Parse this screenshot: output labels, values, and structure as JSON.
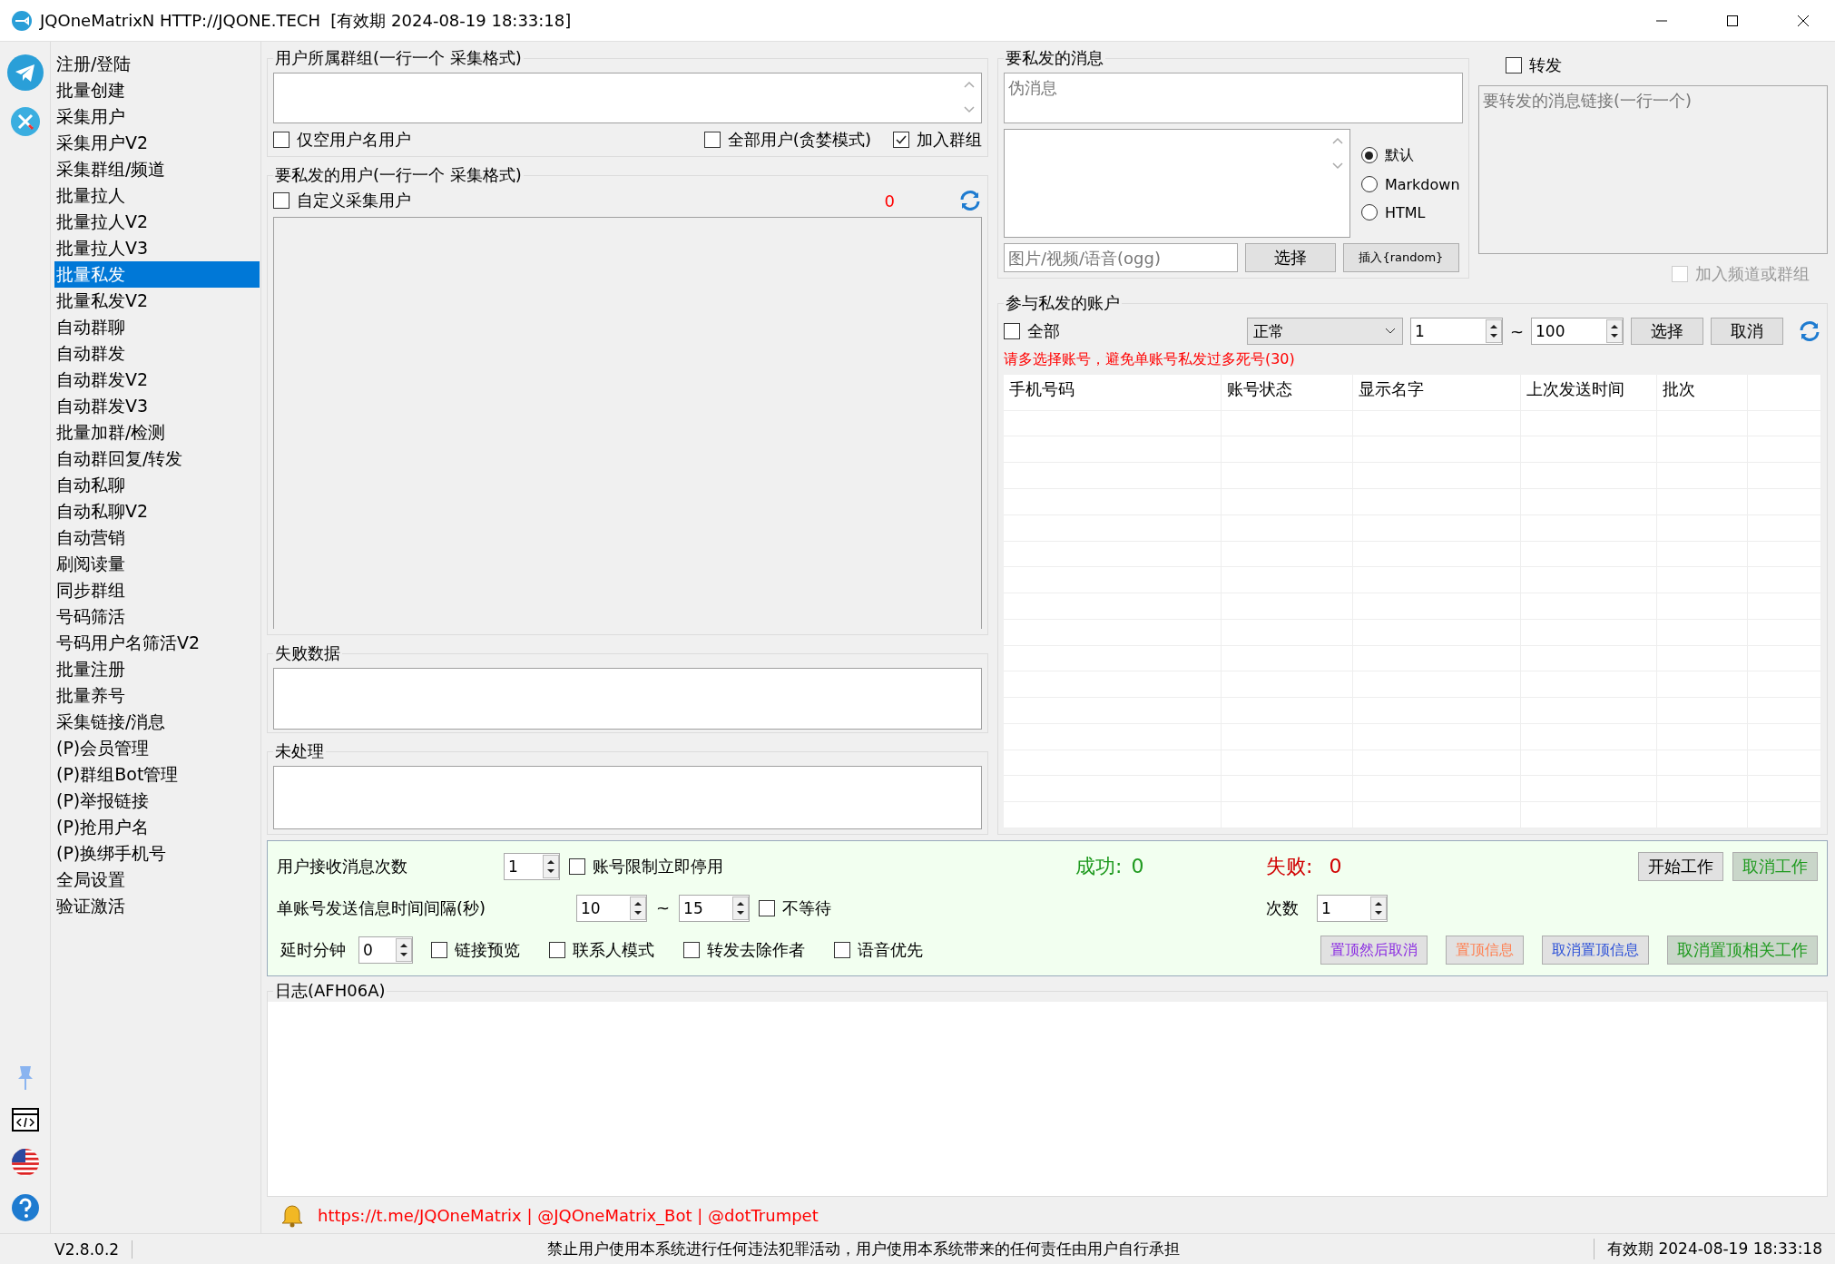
{
  "window": {
    "title": "JQOneMatrixN HTTP://JQONE.TECH  [有效期 2024-08-19 18:33:18]"
  },
  "nav": {
    "items": [
      {
        "label": "注册/登陆",
        "selected": false
      },
      {
        "label": "批量创建",
        "selected": false
      },
      {
        "label": "采集用户",
        "selected": false
      },
      {
        "label": "采集用户V2",
        "selected": false
      },
      {
        "label": "采集群组/频道",
        "selected": false
      },
      {
        "label": "批量拉人",
        "selected": false
      },
      {
        "label": "批量拉人V2",
        "selected": false
      },
      {
        "label": "批量拉人V3",
        "selected": false
      },
      {
        "label": "批量私发",
        "selected": true
      },
      {
        "label": "批量私发V2",
        "selected": false
      },
      {
        "label": "自动群聊",
        "selected": false
      },
      {
        "label": "自动群发",
        "selected": false
      },
      {
        "label": "自动群发V2",
        "selected": false
      },
      {
        "label": "自动群发V3",
        "selected": false
      },
      {
        "label": "批量加群/检测",
        "selected": false
      },
      {
        "label": "自动群回复/转发",
        "selected": false
      },
      {
        "label": "自动私聊",
        "selected": false
      },
      {
        "label": "自动私聊V2",
        "selected": false
      },
      {
        "label": "自动营销",
        "selected": false
      },
      {
        "label": "刷阅读量",
        "selected": false
      },
      {
        "label": "同步群组",
        "selected": false
      },
      {
        "label": "号码筛活",
        "selected": false
      },
      {
        "label": "号码用户名筛活V2",
        "selected": false
      },
      {
        "label": "批量注册",
        "selected": false
      },
      {
        "label": "批量养号",
        "selected": false
      },
      {
        "label": "采集链接/消息",
        "selected": false
      },
      {
        "label": "(P)会员管理",
        "selected": false
      },
      {
        "label": "(P)群组Bot管理",
        "selected": false
      },
      {
        "label": "(P)举报链接",
        "selected": false
      },
      {
        "label": "(P)抢用户名",
        "selected": false
      },
      {
        "label": "(P)换绑手机号",
        "selected": false
      },
      {
        "label": "全局设置",
        "selected": false
      },
      {
        "label": "验证激活",
        "selected": false
      }
    ]
  },
  "user_groups": {
    "title": "用户所属群组(一行一个 采集格式)",
    "options": [
      {
        "label": "仅空用户名用户",
        "checked": false
      },
      {
        "label": "全部用户(贪婪模式)",
        "checked": false
      },
      {
        "label": "加入群组",
        "checked": true
      }
    ]
  },
  "target_users": {
    "title": "要私发的用户(一行一个 采集格式)",
    "custom": {
      "label": "自定义采集用户",
      "checked": false
    },
    "count": "0"
  },
  "failed": {
    "title": "失败数据"
  },
  "unprocessed": {
    "title": "未处理"
  },
  "message": {
    "title": "要私发的消息",
    "placeholder": "伪消息",
    "formats": [
      {
        "label": "默认",
        "selected": true
      },
      {
        "label": "Markdown",
        "selected": false
      },
      {
        "label": "HTML",
        "selected": false
      }
    ],
    "media_placeholder": "图片/视频/语音(ogg)",
    "choose_button": "选择",
    "insert_button": "插入{random}"
  },
  "forward": {
    "label": "转发",
    "checked": false,
    "placeholder": "要转发的消息链接(一行一个)",
    "join": {
      "label": "加入频道或群组",
      "checked": false,
      "disabled": true
    }
  },
  "accounts": {
    "title": "参与私发的账户",
    "all": {
      "label": "全部",
      "checked": false
    },
    "status": "正常",
    "from": "1",
    "tilde": "~",
    "to": "100",
    "select_button": "选择",
    "cancel_button": "取消",
    "warning": "请多选择账号，避免单账号私发过多死号(30)",
    "columns": [
      "手机号码",
      "账号状态",
      "显示名字",
      "上次发送时间",
      "批次"
    ]
  },
  "settings": {
    "receive_label": "用户接收消息次数",
    "receive_value": "1",
    "limit": {
      "label": "账号限制立即停用",
      "checked": false
    },
    "interval_label": "单账号发送信息时间间隔(秒)",
    "interval_from": "10",
    "interval_tilde": "~",
    "interval_to": "15",
    "no_wait": {
      "label": "不等待",
      "checked": false
    },
    "delay_label": "延时分钟",
    "delay_value": "0",
    "options": [
      {
        "label": "链接预览",
        "checked": false
      },
      {
        "label": "联系人模式",
        "checked": false
      },
      {
        "label": "转发去除作者",
        "checked": false
      },
      {
        "label": "语音优先",
        "checked": false
      }
    ],
    "success_label": "成功:",
    "success_value": "0",
    "fail_label": "失败:",
    "fail_value": "0",
    "times_label": "次数",
    "times_value": "1",
    "top_buttons": [
      {
        "label": "开始工作",
        "color": "#000000"
      },
      {
        "label": "取消工作",
        "color": "#1f9a1f"
      }
    ],
    "pin_buttons": [
      {
        "label": "置顶然后取消",
        "color": "#8a2be2"
      },
      {
        "label": "置顶信息",
        "color": "#ff7f50"
      },
      {
        "label": "取消置顶信息",
        "color": "#2a4fd8"
      },
      {
        "label": "取消置顶相关工作",
        "color": "#1f9a1f"
      }
    ]
  },
  "log": {
    "title": "日志(AFH06A)"
  },
  "footer": {
    "links": "https://t.me/JQOneMatrix | @JQOneMatrix_Bot | @dotTrumpet"
  },
  "status_bar": {
    "version": "V2.8.0.2",
    "notice": "禁止用户使用本系统进行任何违法犯罪活动，用户使用本系统带来的任何责任由用户自行承担",
    "expiry": "有效期 2024-08-19 18:33:18"
  }
}
